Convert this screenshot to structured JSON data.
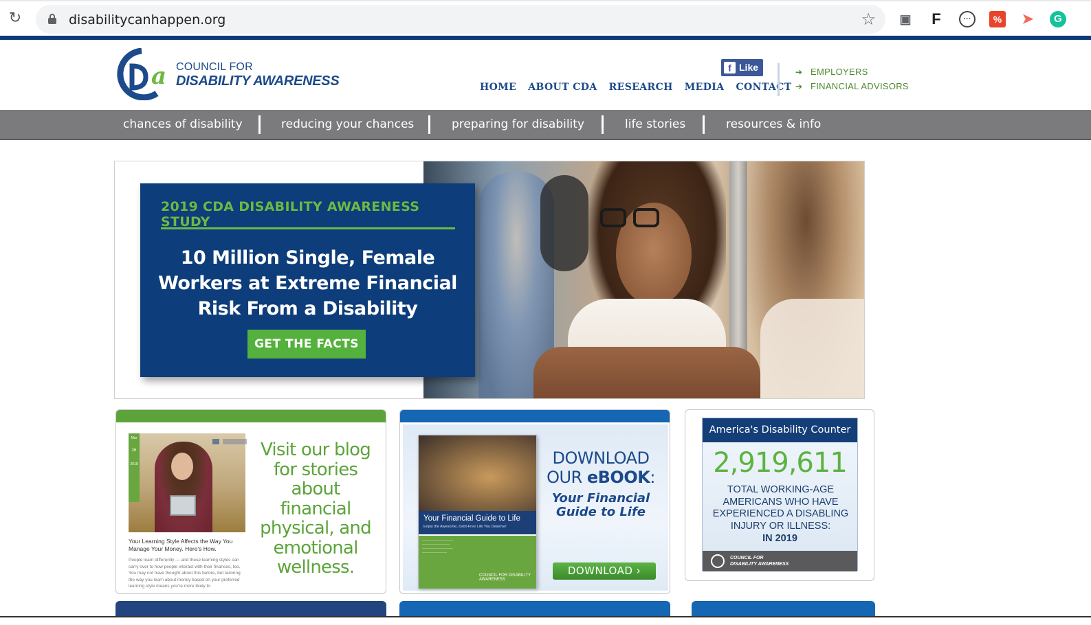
{
  "browser": {
    "url": "disabilitycanhappen.org",
    "extensions": [
      "camera-icon",
      "f-icon",
      "dots-icon",
      "percent-icon",
      "play-icon",
      "grammarly-icon"
    ]
  },
  "header": {
    "logo_line1": "COUNCIL FOR",
    "logo_line2": "DISABILITY AWARENESS",
    "fb_like": "Like",
    "nav": [
      "HOME",
      "ABOUT CDA",
      "RESEARCH",
      "MEDIA",
      "CONTACT"
    ],
    "side_links": [
      "EMPLOYERS",
      "FINANCIAL ADVISORS"
    ]
  },
  "menu": [
    "chances of disability",
    "reducing your chances",
    "preparing for disability",
    "life stories",
    "resources & info"
  ],
  "hero": {
    "kicker": "2019 CDA DISABILITY AWARENESS STUDY",
    "headline_l1": "10 Million Single, Female",
    "headline_l2": "Workers at Extreme Financial",
    "headline_l3": "Risk From a Disability",
    "button": "GET THE FACTS"
  },
  "blog": {
    "caption": "Your Learning Style Affects the Way You Manage Your Money. Here's How.",
    "body": "People learn differently — and these learning styles can carry over to how people interact with their finances, too. You may not have thought about this before, but tailoring the way you learn about money based on your preferred learning style means you're more likely to",
    "text_l1": "Visit our blog",
    "text_l2": "for stories",
    "text_l3": "about",
    "text_l4": "financial",
    "text_l5": "physical, and",
    "text_l6": "emotional",
    "text_l7": "wellness.",
    "date_month": "Mar",
    "date_day": "26",
    "date_year": "2019"
  },
  "ebook": {
    "cover_title": "Your Financial Guide to Life",
    "cover_sub": "Enjoy the Awesome, Debt-Free Life You Deserve!",
    "cover_logo": "COUNCIL FOR DISABILITY AWARENESS",
    "head_l1": "DOWNLOAD",
    "head_l2_pre": "OUR ",
    "head_l2_bold": "eBOOK",
    "head_l2_post": ":",
    "sub_l1": "Your Financial",
    "sub_l2": "Guide to Life",
    "button": "DOWNLOAD"
  },
  "counter": {
    "title": "America's Disability Counter",
    "number": "2,919,611",
    "text_l1": "TOTAL WORKING-AGE",
    "text_l2": "AMERICANS WHO HAVE",
    "text_l3": "EXPERIENCED A DISABLING",
    "text_l4": "INJURY OR ILLNESS:",
    "year": "IN 2019",
    "foot_l1": "COUNCIL FOR",
    "foot_l2": "DISABILITY AWARENESS"
  },
  "colors": {
    "brand_blue": "#0d3d7a",
    "brand_green": "#5ca43a",
    "menu_gray": "#7b7b7d"
  }
}
